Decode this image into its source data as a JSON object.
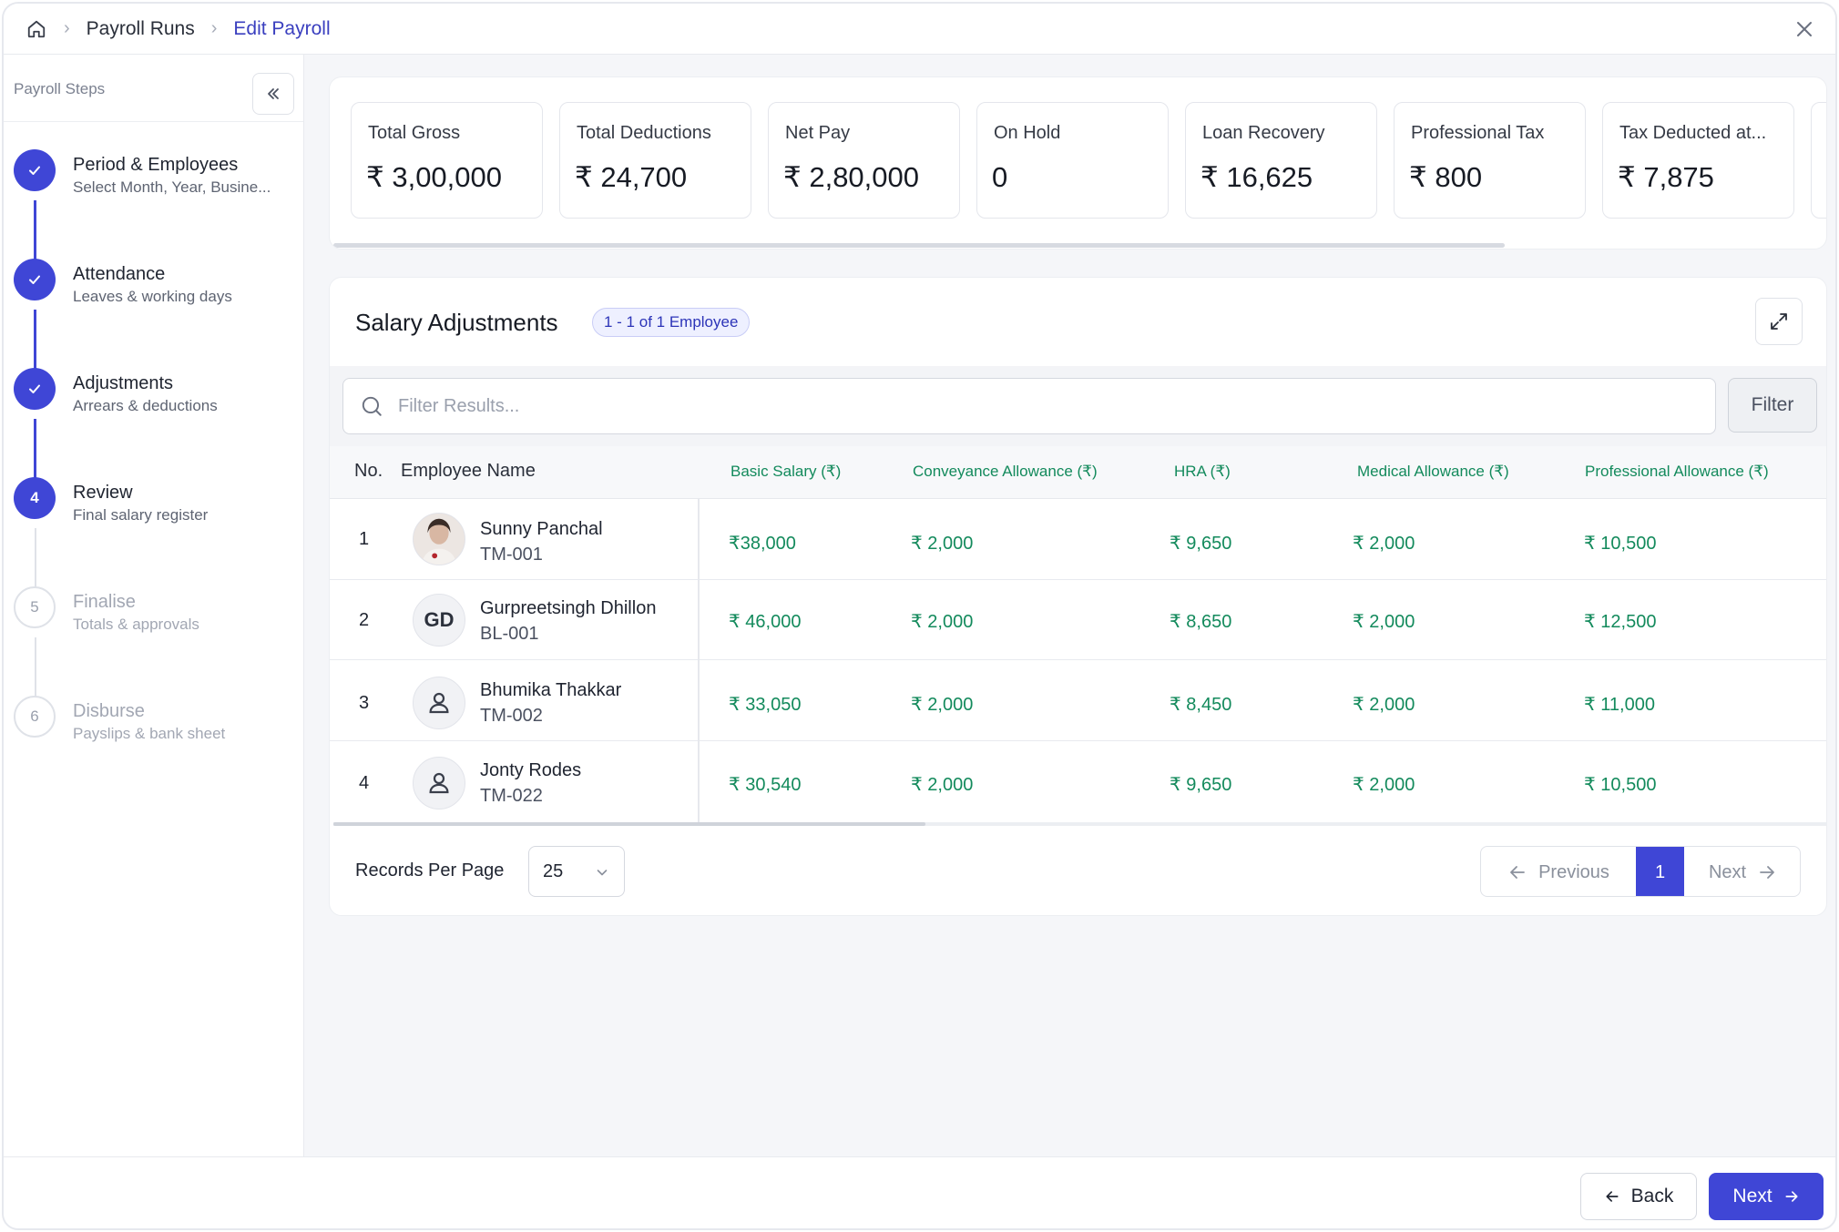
{
  "breadcrumb": {
    "items": [
      "Payroll Runs",
      "Edit Payroll"
    ]
  },
  "sidebar": {
    "title": "Payroll Steps",
    "steps": [
      {
        "num": "",
        "title": "Period & Employees",
        "subtitle": "Select Month, Year, Busine...",
        "state": "done"
      },
      {
        "num": "",
        "title": "Attendance",
        "subtitle": "Leaves & working days",
        "state": "done"
      },
      {
        "num": "",
        "title": "Adjustments",
        "subtitle": "Arrears & deductions",
        "state": "done"
      },
      {
        "num": "4",
        "title": "Review",
        "subtitle": "Final salary register",
        "state": "current"
      },
      {
        "num": "5",
        "title": "Finalise",
        "subtitle": "Totals & approvals",
        "state": "pending"
      },
      {
        "num": "6",
        "title": "Disburse",
        "subtitle": "Payslips & bank sheet",
        "state": "pending"
      }
    ]
  },
  "kpis": [
    {
      "label": "Total Gross",
      "value": "₹ 3,00,000"
    },
    {
      "label": "Total Deductions",
      "value": "₹ 24,700"
    },
    {
      "label": "Net Pay",
      "value": "₹ 2,80,000"
    },
    {
      "label": "On Hold",
      "value": "0"
    },
    {
      "label": "Loan Recovery",
      "value": "₹ 16,625"
    },
    {
      "label": "Professional Tax",
      "value": "₹ 800"
    },
    {
      "label": "Tax Deducted at...",
      "value": "₹ 7,875"
    }
  ],
  "salary_panel": {
    "title": "Salary Adjustments",
    "badge": "1 - 1 of 1 Employee",
    "search_placeholder": "Filter Results...",
    "filter_label": "Filter",
    "columns": [
      "No.",
      "Employee Name",
      "Basic Salary (₹)",
      "Conveyance Allowance (₹)",
      "HRA (₹)",
      "Medical Allowance (₹)",
      "Professional Allowance (₹)"
    ],
    "rows": [
      {
        "no": "1",
        "name": "Sunny Panchal",
        "id": "TM-001",
        "avatar": "photo",
        "initials": "",
        "basic": "₹38,000",
        "conveyance": "₹ 2,000",
        "hra": "₹ 9,650",
        "medical": "₹ 2,000",
        "professional": "₹ 10,500"
      },
      {
        "no": "2",
        "name": "Gurpreetsingh Dhillon",
        "id": "BL-001",
        "avatar": "initials",
        "initials": "GD",
        "basic": "₹ 46,000",
        "conveyance": "₹ 2,000",
        "hra": "₹ 8,650",
        "medical": "₹ 2,000",
        "professional": "₹ 12,500"
      },
      {
        "no": "3",
        "name": "Bhumika Thakkar",
        "id": "TM-002",
        "avatar": "user-icon",
        "initials": "",
        "basic": "₹ 33,050",
        "conveyance": "₹ 2,000",
        "hra": "₹ 8,450",
        "medical": "₹ 2,000",
        "professional": "₹ 11,000"
      },
      {
        "no": "4",
        "name": "Jonty Rodes",
        "id": "TM-022",
        "avatar": "user-icon",
        "initials": "",
        "basic": "₹ 30,540",
        "conveyance": "₹ 2,000",
        "hra": "₹ 9,650",
        "medical": "₹ 2,000",
        "professional": "₹ 10,500"
      }
    ],
    "records_per_page_label": "Records Per Page",
    "records_per_page": "25",
    "pagination": {
      "previous": "Previous",
      "current": "1",
      "next": "Next"
    }
  },
  "footer": {
    "back_label": "Back",
    "next_label": "Next"
  },
  "colors": {
    "accent": "#3f46d6",
    "money": "#138a5c"
  }
}
